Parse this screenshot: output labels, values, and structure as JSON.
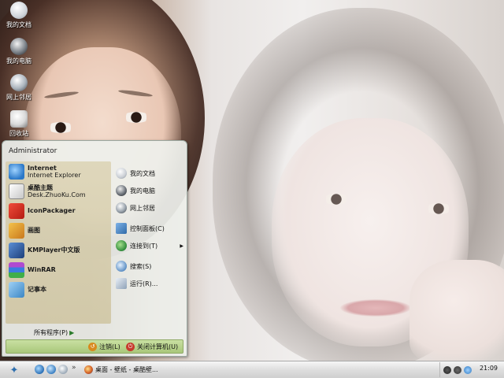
{
  "desktop": {
    "icons": [
      {
        "label": "我的文档"
      },
      {
        "label": "我的电脑"
      },
      {
        "label": "网上邻居"
      },
      {
        "label": "回收站"
      }
    ]
  },
  "start_menu": {
    "user": "Administrator",
    "programs": [
      {
        "name": "Internet",
        "sub": "Internet Explorer"
      },
      {
        "name": "桌酷主题",
        "sub": "Desk.ZhuoKu.Com"
      },
      {
        "name": "IconPackager",
        "sub": ""
      },
      {
        "name": "画图",
        "sub": ""
      },
      {
        "name": "KMPlayer中文版",
        "sub": ""
      },
      {
        "name": "WinRAR",
        "sub": ""
      },
      {
        "name": "记事本",
        "sub": ""
      }
    ],
    "places": [
      {
        "label": "我的文档"
      },
      {
        "label": "我的电脑"
      },
      {
        "label": "网上邻居"
      },
      {
        "label": "控制面板(C)"
      },
      {
        "label": "连接到(T)"
      },
      {
        "label": "搜索(S)"
      },
      {
        "label": "运行(R)..."
      }
    ],
    "all_programs": "所有程序(P)",
    "logoff": "注销(L)",
    "shutdown": "关闭计算机(U)"
  },
  "taskbar": {
    "quicklaunch_more": "»",
    "tasks": [
      {
        "label": "桌面 - 壁纸 - 桌酷壁..."
      }
    ],
    "clock": "21:09"
  },
  "colors": {
    "start_accent": "#2e6fae",
    "footer_green": "#a9c77a",
    "left_panel": "#cfc08f"
  }
}
